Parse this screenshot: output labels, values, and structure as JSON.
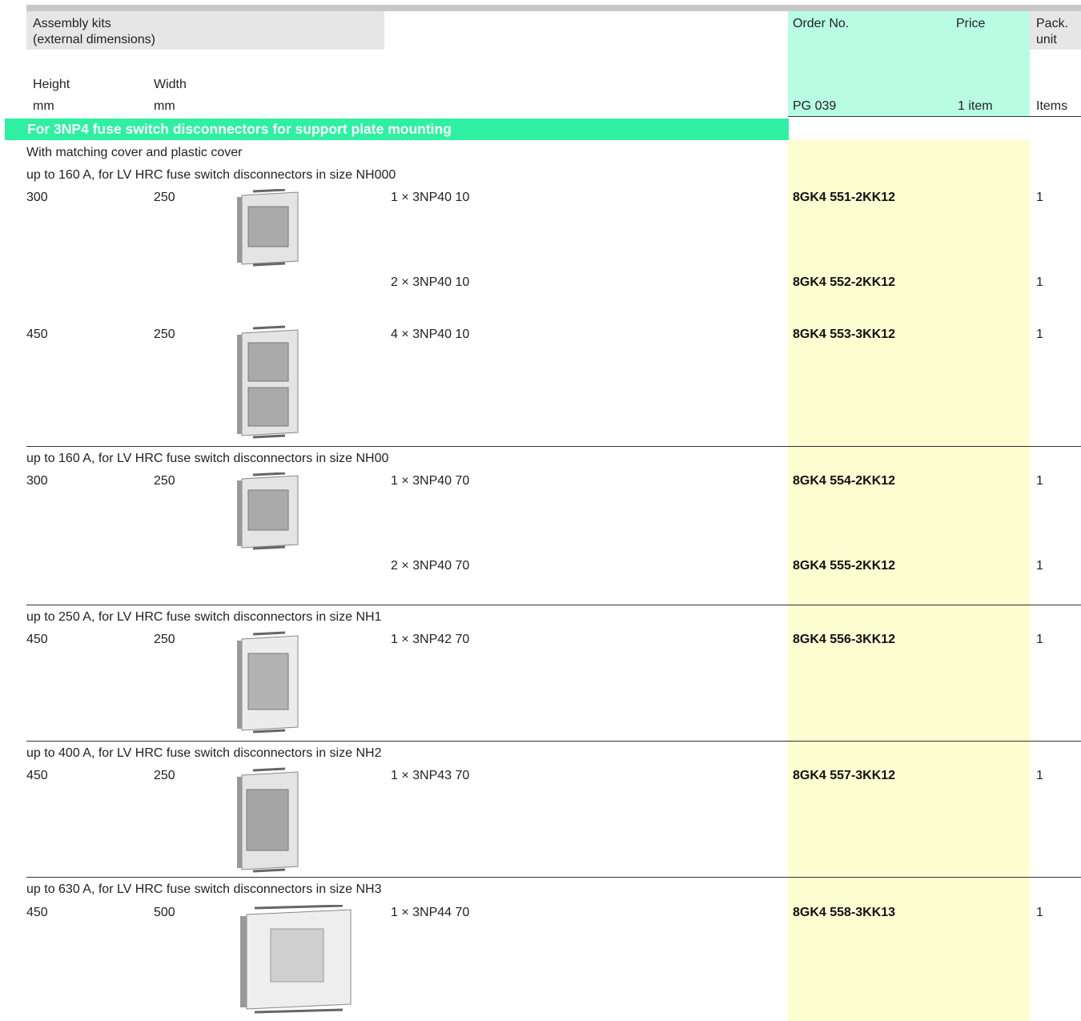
{
  "header": {
    "title_line1": "Assembly kits",
    "title_line2": "(external dimensions)",
    "order_no": "Order No.",
    "price": "Price",
    "pack_line1": "Pack.",
    "pack_line2": "unit",
    "height": "Height",
    "width": "Width",
    "height_unit": "mm",
    "width_unit": "mm",
    "pg": "PG 039",
    "price_unit": "1 item",
    "pack_unit": "Items"
  },
  "section_title": "For 3NP4 fuse switch disconnectors for support plate mounting",
  "intro": "With matching cover and plastic cover",
  "groups": [
    {
      "title": "up to 160 A, for LV HRC fuse switch disconnectors in size NH000",
      "rows": [
        {
          "height": "300",
          "width": "250",
          "desc": "1 × 3NP40 10",
          "order": "8GK4 551-2KK12",
          "pack": "1"
        },
        {
          "height": "",
          "width": "",
          "desc": "2 × 3NP40 10",
          "order": "8GK4 552-2KK12",
          "pack": "1"
        },
        {
          "height": "450",
          "width": "250",
          "desc": "4 × 3NP40 10",
          "order": "8GK4 553-3KK12",
          "pack": "1"
        }
      ]
    },
    {
      "title": "up to 160 A, for LV HRC fuse switch disconnectors in size NH00",
      "rows": [
        {
          "height": "300",
          "width": "250",
          "desc": "1 × 3NP40 70",
          "order": "8GK4 554-2KK12",
          "pack": "1"
        },
        {
          "height": "",
          "width": "",
          "desc": "2 × 3NP40 70",
          "order": "8GK4 555-2KK12",
          "pack": "1"
        }
      ]
    },
    {
      "title": "up to 250 A, for LV HRC fuse switch disconnectors in size NH1",
      "rows": [
        {
          "height": "450",
          "width": "250",
          "desc": "1 × 3NP42 70",
          "order": "8GK4 556-3KK12",
          "pack": "1"
        }
      ]
    },
    {
      "title": "up to 400 A, for LV HRC fuse switch disconnectors in size NH2",
      "rows": [
        {
          "height": "450",
          "width": "250",
          "desc": "1 × 3NP43 70",
          "order": "8GK4 557-3KK12",
          "pack": "1"
        }
      ]
    },
    {
      "title": "up to 630 A, for LV HRC fuse switch disconnectors in size NH3",
      "rows": [
        {
          "height": "450",
          "width": "500",
          "desc": "1 × 3NP44 70",
          "order": "8GK4 558-3KK13",
          "pack": "1"
        }
      ]
    }
  ],
  "colors": {
    "header_grey": "#e6e6e6",
    "header_mint": "#b8fce4",
    "section_green": "#2ff0a2",
    "order_column": "#fdfdd2"
  }
}
